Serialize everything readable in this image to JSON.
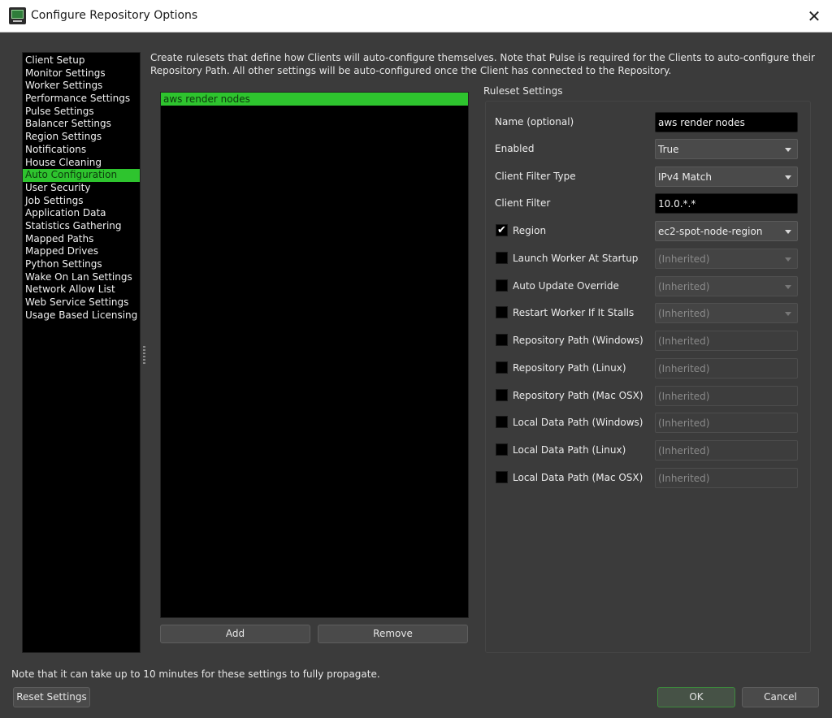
{
  "window": {
    "title": "Configure Repository Options",
    "close_icon": "close-icon",
    "app_icon": "monitor-icon"
  },
  "sidebar": {
    "selected_index": 9,
    "items": [
      {
        "label": "Client Setup"
      },
      {
        "label": "Monitor Settings"
      },
      {
        "label": "Worker Settings"
      },
      {
        "label": "Performance Settings"
      },
      {
        "label": "Pulse Settings"
      },
      {
        "label": "Balancer Settings"
      },
      {
        "label": "Region Settings"
      },
      {
        "label": "Notifications"
      },
      {
        "label": "House Cleaning"
      },
      {
        "label": "Auto Configuration"
      },
      {
        "label": "User Security"
      },
      {
        "label": "Job Settings"
      },
      {
        "label": "Application Data"
      },
      {
        "label": "Statistics Gathering"
      },
      {
        "label": "Mapped Paths"
      },
      {
        "label": "Mapped Drives"
      },
      {
        "label": "Python Settings"
      },
      {
        "label": "Wake On Lan Settings"
      },
      {
        "label": "Network Allow List"
      },
      {
        "label": "Web Service Settings"
      },
      {
        "label": "Usage Based Licensing"
      }
    ]
  },
  "main": {
    "description": "Create rulesets that define how Clients will auto-configure themselves. Note that Pulse is required for the Clients to auto-configure their Repository Path. All other settings will be auto-configured once the Client has connected to the Repository.",
    "rulesets": [
      {
        "name": "aws render nodes",
        "selected": true
      }
    ],
    "add_label": "Add",
    "remove_label": "Remove"
  },
  "ruleset_settings": {
    "title": "Ruleset Settings",
    "fields": [
      {
        "label": "Name (optional)",
        "type": "input",
        "value": "aws render nodes",
        "checkbox": null
      },
      {
        "label": "Enabled",
        "type": "select",
        "value": "True",
        "checkbox": null
      },
      {
        "label": "Client Filter Type",
        "type": "select",
        "value": "IPv4 Match",
        "checkbox": null
      },
      {
        "label": "Client Filter",
        "type": "input",
        "value": "10.0.*.*",
        "checkbox": null
      },
      {
        "label": "Region",
        "type": "select",
        "value": "ec2-spot-node-region",
        "checkbox": true
      },
      {
        "label": "Launch Worker At Startup",
        "type": "select",
        "value": "(Inherited)",
        "checkbox": false
      },
      {
        "label": "Auto Update Override",
        "type": "select",
        "value": "(Inherited)",
        "checkbox": false
      },
      {
        "label": "Restart Worker If It Stalls",
        "type": "select",
        "value": "(Inherited)",
        "checkbox": false
      },
      {
        "label": "Repository Path (Windows)",
        "type": "input",
        "value": "(Inherited)",
        "checkbox": false
      },
      {
        "label": "Repository Path (Linux)",
        "type": "input",
        "value": "(Inherited)",
        "checkbox": false
      },
      {
        "label": "Repository Path (Mac OSX)",
        "type": "input",
        "value": "(Inherited)",
        "checkbox": false
      },
      {
        "label": "Local Data Path (Windows)",
        "type": "input",
        "value": "(Inherited)",
        "checkbox": false
      },
      {
        "label": "Local Data Path (Linux)",
        "type": "input",
        "value": "(Inherited)",
        "checkbox": false
      },
      {
        "label": "Local Data Path (Mac OSX)",
        "type": "input",
        "value": "(Inherited)",
        "checkbox": false
      }
    ],
    "check_glyph": "✔"
  },
  "footer": {
    "note": "Note that it can take up to 10 minutes for these settings to fully propagate.",
    "reset_label": "Reset Settings",
    "ok_label": "OK",
    "cancel_label": "Cancel"
  },
  "colors": {
    "accent_green": "#2ec42e",
    "background": "#3b3b3b",
    "list_background": "#000000"
  }
}
